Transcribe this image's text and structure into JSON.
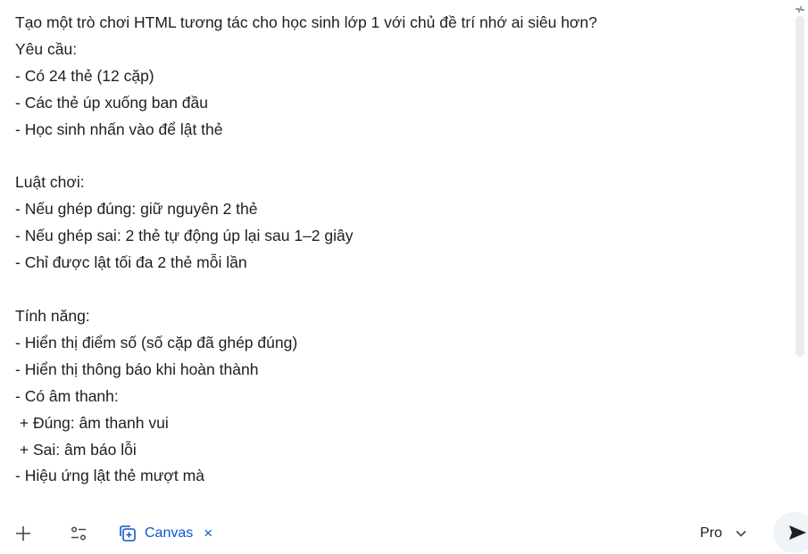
{
  "prompt": {
    "lines": [
      "Tạo một trò chơi HTML tương tác cho học sinh lớp 1 với chủ đề trí nhớ ai siêu hơn?",
      "Yêu cầu:",
      "- Có 24 thẻ (12 cặp)",
      "- Các thẻ úp xuống ban đầu",
      "- Học sinh nhấn vào để lật thẻ",
      "",
      "Luật chơi:",
      "- Nếu ghép đúng: giữ nguyên 2 thẻ",
      "- Nếu ghép sai: 2 thẻ tự động úp lại sau 1–2 giây",
      "- Chỉ được lật tối đa 2 thẻ mỗi lần",
      "",
      "Tính năng:",
      "- Hiển thị điểm số (số cặp đã ghép đúng)",
      "- Hiển thị thông báo khi hoàn thành",
      "- Có âm thanh:",
      " + Đúng: âm thanh vui",
      " + Sai: âm báo lỗi",
      "- Hiệu ứng lật thẻ mượt mà"
    ]
  },
  "toolbar": {
    "add_icon": "plus-icon",
    "tools_icon": "tune-icon",
    "canvas_icon": "canvas-icon",
    "canvas_label": "Canvas",
    "canvas_close": "×",
    "model_label": "Pro",
    "send_icon": "send-icon"
  },
  "colors": {
    "text": "#1f1f1f",
    "accent": "#0b57d0",
    "send_bg": "#f0f4f9",
    "scrollbar": "#ececec"
  }
}
